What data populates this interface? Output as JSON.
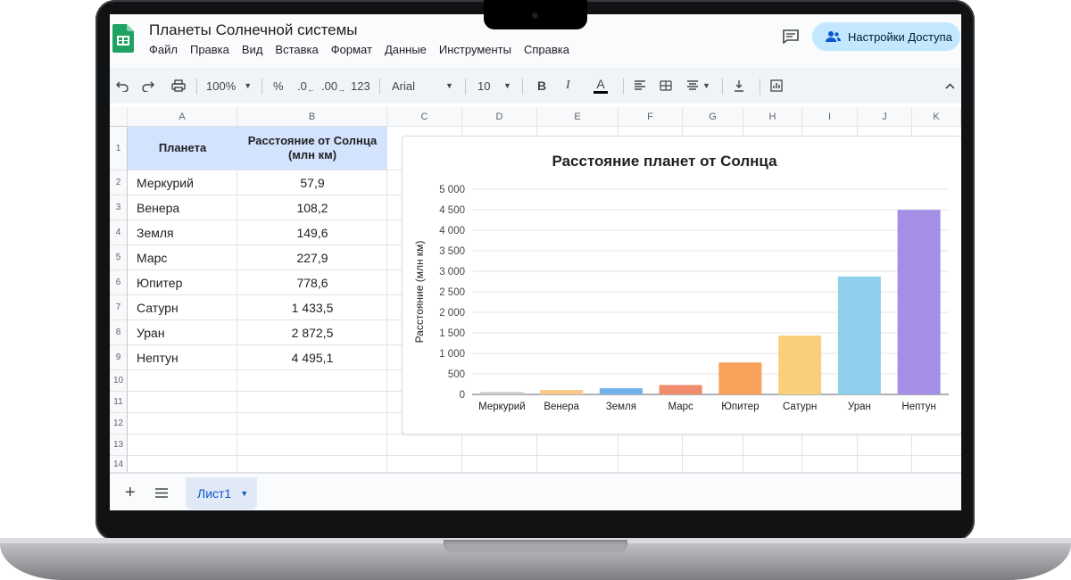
{
  "app": {
    "title": "Планеты Солнечной системы",
    "menu": [
      "Файл",
      "Правка",
      "Вид",
      "Вставка",
      "Формат",
      "Данные",
      "Инструменты",
      "Справка"
    ],
    "share_label": "Настройки Доступа"
  },
  "toolbar": {
    "zoom": "100%",
    "percent": "%",
    "dec_decrease": ".0",
    "dec_increase": ".00",
    "number_format": "123",
    "font": "Arial",
    "font_size": "10",
    "bold": "B",
    "italic": "I",
    "text_color": "A"
  },
  "grid": {
    "columns": [
      "A",
      "B",
      "C",
      "D",
      "E",
      "F",
      "G",
      "H",
      "I",
      "J",
      "K"
    ],
    "rows": [
      "1",
      "2",
      "3",
      "4",
      "5",
      "6",
      "7",
      "8",
      "9",
      "10",
      "11",
      "12",
      "13",
      "14"
    ],
    "header": {
      "planet": "Планета",
      "distance": "Расстояние от Солнца (млн км)"
    },
    "data": [
      {
        "planet": "Меркурий",
        "distance": "57,9"
      },
      {
        "planet": "Венера",
        "distance": "108,2"
      },
      {
        "planet": "Земля",
        "distance": "149,6"
      },
      {
        "planet": "Марс",
        "distance": "227,9"
      },
      {
        "planet": "Юпитер",
        "distance": "778,6"
      },
      {
        "planet": "Сатурн",
        "distance": "1 433,5"
      },
      {
        "planet": "Уран",
        "distance": "2 872,5"
      },
      {
        "planet": "Нептун",
        "distance": "4 495,1"
      }
    ]
  },
  "sheets": {
    "active": "Лист1"
  },
  "chart_data": {
    "type": "bar",
    "title": "Расстояние планет от Солнца",
    "xlabel": "",
    "ylabel": "Расстояние (млн км)",
    "ylim": [
      0,
      5000
    ],
    "yticks": [
      "0",
      "500",
      "1 000",
      "1 500",
      "2 000",
      "2 500",
      "3 000",
      "3 500",
      "4 000",
      "4 500",
      "5 000"
    ],
    "categories": [
      "Меркурий",
      "Венера",
      "Земля",
      "Марс",
      "Юпитер",
      "Сатурн",
      "Уран",
      "Нептун"
    ],
    "values": [
      57.9,
      108.2,
      149.6,
      227.9,
      778.6,
      1433.5,
      2872.5,
      4495.1
    ],
    "colors": [
      "#c7c9cd",
      "#f9c98a",
      "#6fb2ea",
      "#f08c6c",
      "#f9a25c",
      "#f8cf7d",
      "#8fd0ec",
      "#a48ee6"
    ],
    "grid": true,
    "legend": "none"
  }
}
